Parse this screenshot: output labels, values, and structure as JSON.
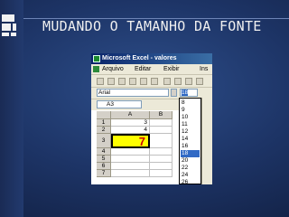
{
  "slide": {
    "title": "MUDANDO O TAMANHO DA FONTE"
  },
  "excel": {
    "window_title": "Microsoft Excel - valores",
    "menu": [
      "Arquivo",
      "Editar",
      "Exibir",
      "Ins"
    ],
    "font_name": "Arial",
    "font_size": "18",
    "name_box": "A3",
    "columns": [
      "A",
      "B"
    ],
    "rows": [
      {
        "num": "1",
        "a": "3"
      },
      {
        "num": "2",
        "a": "4"
      },
      {
        "num": "3",
        "a": "7"
      },
      {
        "num": "4",
        "a": ""
      },
      {
        "num": "5",
        "a": ""
      },
      {
        "num": "6",
        "a": ""
      },
      {
        "num": "7",
        "a": ""
      }
    ],
    "size_options": [
      "8",
      "9",
      "10",
      "11",
      "12",
      "14",
      "16",
      "18",
      "20",
      "22",
      "24",
      "26"
    ],
    "selected_size": "18",
    "highlight_color": "#ffff00",
    "value_color": "#cc0000"
  }
}
